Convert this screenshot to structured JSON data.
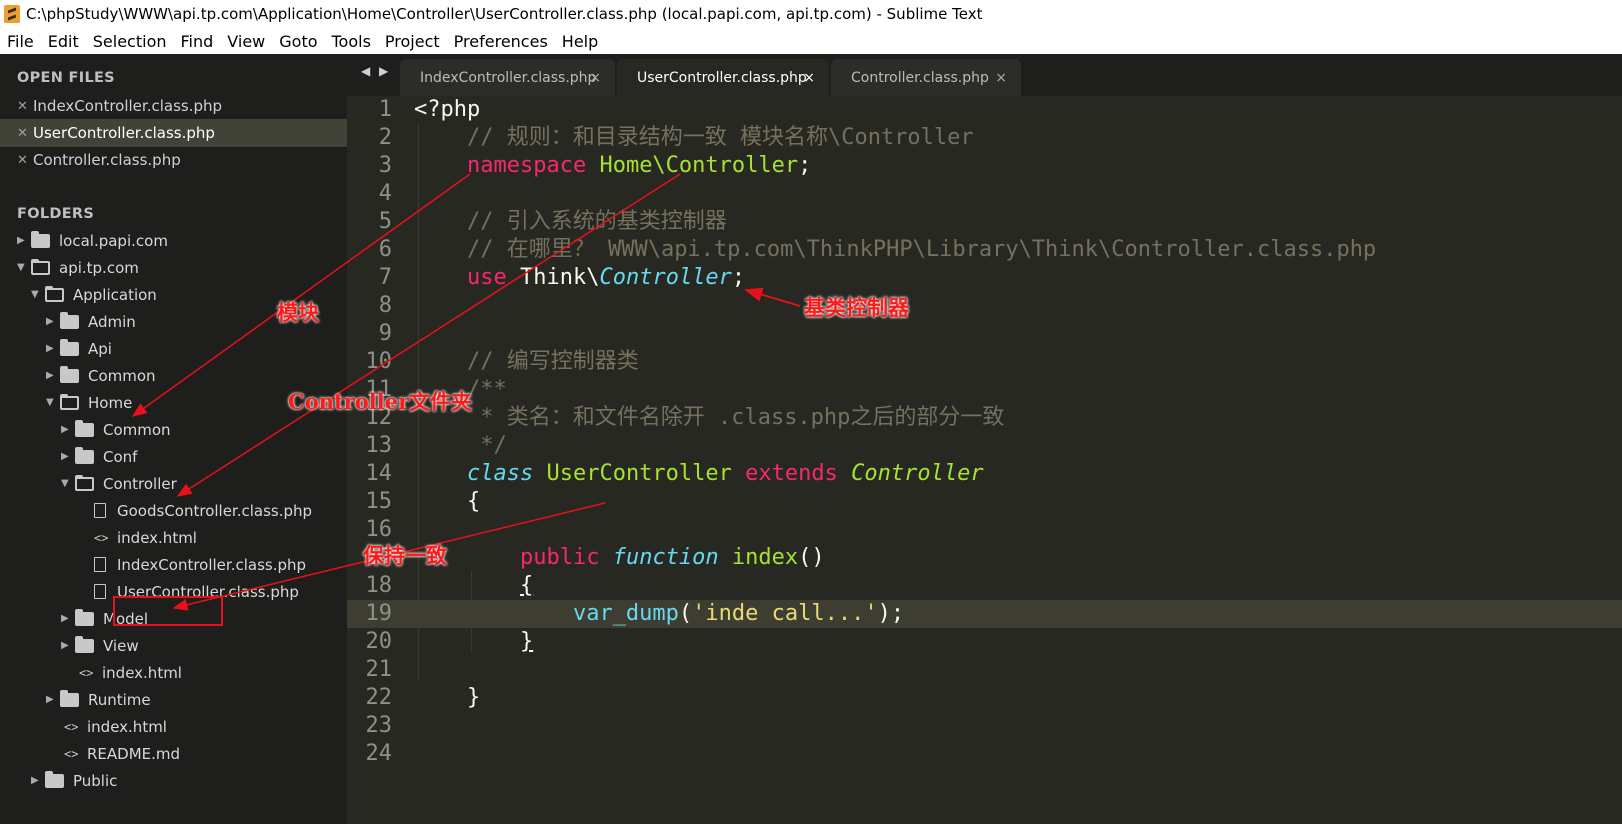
{
  "window": {
    "title": "C:\\phpStudy\\WWW\\api.tp.com\\Application\\Home\\Controller\\UserController.class.php (local.papi.com, api.tp.com) - Sublime Text"
  },
  "menu": [
    "File",
    "Edit",
    "Selection",
    "Find",
    "View",
    "Goto",
    "Tools",
    "Project",
    "Preferences",
    "Help"
  ],
  "sidebar": {
    "open_files_label": "OPEN FILES",
    "open_files": [
      "IndexController.class.php",
      "UserController.class.php",
      "Controller.class.php"
    ],
    "folders_label": "FOLDERS",
    "tree": [
      {
        "label": "local.papi.com",
        "type": "folder"
      },
      {
        "label": "api.tp.com",
        "type": "folder-open"
      },
      {
        "label": "Application",
        "type": "folder-open"
      },
      {
        "label": "Admin",
        "type": "folder"
      },
      {
        "label": "Api",
        "type": "folder"
      },
      {
        "label": "Common",
        "type": "folder"
      },
      {
        "label": "Home",
        "type": "folder-open"
      },
      {
        "label": "Common",
        "type": "folder"
      },
      {
        "label": "Conf",
        "type": "folder"
      },
      {
        "label": "Controller",
        "type": "folder-open"
      },
      {
        "label": "GoodsController.class.php",
        "type": "file"
      },
      {
        "label": "index.html",
        "type": "code"
      },
      {
        "label": "IndexController.class.php",
        "type": "file"
      },
      {
        "label": "UserController.class.php",
        "type": "file"
      },
      {
        "label": "Model",
        "type": "folder"
      },
      {
        "label": "View",
        "type": "folder"
      },
      {
        "label": "index.html",
        "type": "code"
      },
      {
        "label": "Runtime",
        "type": "folder"
      },
      {
        "label": "index.html",
        "type": "code"
      },
      {
        "label": "README.md",
        "type": "code"
      },
      {
        "label": "Public",
        "type": "folder"
      }
    ]
  },
  "tabs": [
    {
      "label": "IndexController.class.php",
      "close": "×"
    },
    {
      "label": "UserController.class.php",
      "close": "×"
    },
    {
      "label": "Controller.class.php",
      "close": "×"
    }
  ],
  "editor": {
    "line_numbers": [
      "1",
      "2",
      "3",
      "4",
      "5",
      "6",
      "7",
      "8",
      "9",
      "10",
      "11",
      "12",
      "13",
      "14",
      "15",
      "16",
      "17",
      "18",
      "19",
      "20",
      "21",
      "22",
      "23",
      "24"
    ],
    "current_line": 19,
    "code": {
      "l1": "<?php",
      "l2": "// 规则：和目录结构一致 模块名称\\Controller",
      "l3_kw": "namespace",
      "l3_ns": "Home\\Controller",
      "l3_end": ";",
      "l5": "// 引入系统的基类控制器",
      "l6": "// 在哪里？ WWW\\api.tp.com\\ThinkPHP\\Library\\Think\\Controller.class.php",
      "l7_kw": "use",
      "l7_a": "Think\\",
      "l7_cls": "Controller",
      "l7_end": ";",
      "l10": "// 编写控制器类",
      "l11": "/**",
      "l12": " * 类名：和文件名除开 .class.php之后的部分一致",
      "l13": " */",
      "l14_kw": "class",
      "l14_name": "UserController",
      "l14_ext": "extends",
      "l14_parent": "Controller",
      "l15": "{",
      "l17_pub": "public",
      "l17_func": "function",
      "l17_name": "index",
      "l17_paren": "()",
      "l18": "{",
      "l19_fn": "var_dump",
      "l19_open": "(",
      "l19_str": "'inde call...'",
      "l19_end": ");",
      "l20": "}",
      "l22": "}"
    }
  },
  "annotations": {
    "module": "模块",
    "controller_folder": "Controller文件夹",
    "base_controller": "基类控制器",
    "consistent": "保持一致"
  },
  "colors": {
    "annotation": "#ff1a1a",
    "keyword": "#f92672",
    "entity": "#a6e22e",
    "type": "#66d9ef",
    "comment": "#75715e",
    "string": "#e6db74"
  }
}
